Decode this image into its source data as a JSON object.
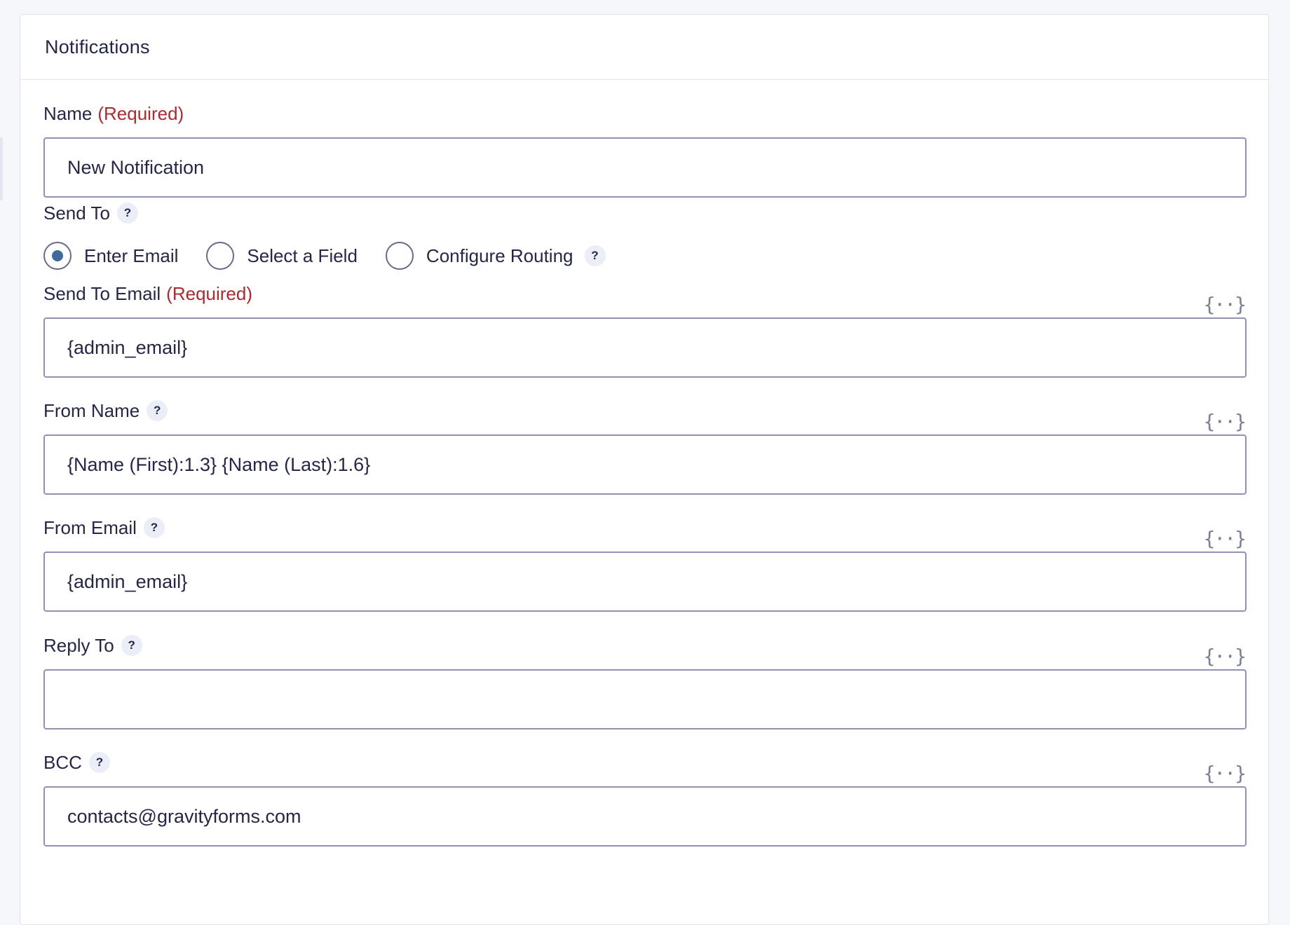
{
  "panel": {
    "title": "Notifications"
  },
  "required_text": "(Required)",
  "help_glyph": "?",
  "merge_tag_glyph": "{··}",
  "name_field": {
    "label": "Name",
    "value": "New Notification"
  },
  "send_to": {
    "label": "Send To",
    "options": [
      {
        "label": "Enter Email",
        "checked": true
      },
      {
        "label": "Select a Field",
        "checked": false
      },
      {
        "label": "Configure Routing",
        "checked": false
      }
    ]
  },
  "send_to_email": {
    "label": "Send To Email",
    "value": "{admin_email}"
  },
  "from_name": {
    "label": "From Name",
    "value": "{Name (First):1.3} {Name (Last):1.6}"
  },
  "from_email": {
    "label": "From Email",
    "value": "{admin_email}"
  },
  "reply_to": {
    "label": "Reply To",
    "value": ""
  },
  "bcc": {
    "label": "BCC",
    "value": "contacts@gravityforms.com"
  },
  "colors": {
    "required": "#b0292e",
    "radio_checked": "#3e6b9b",
    "input_border": "#9092b2"
  }
}
